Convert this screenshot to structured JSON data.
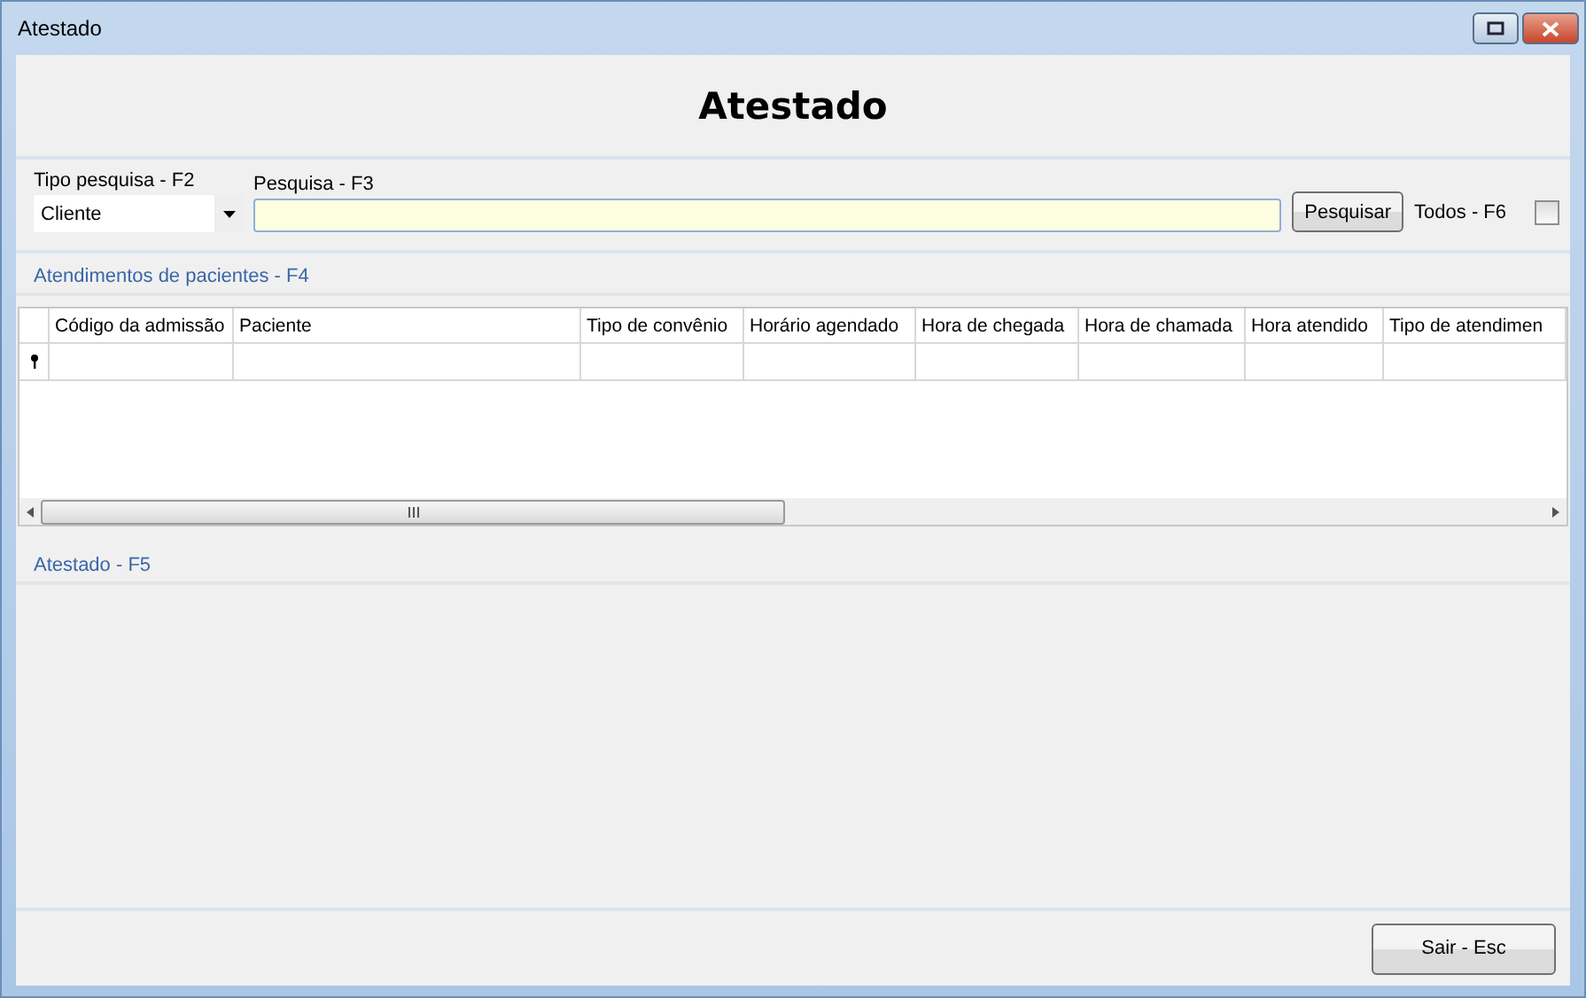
{
  "window": {
    "title": "Atestado"
  },
  "header": {
    "title": "Atestado"
  },
  "search": {
    "type_label": "Tipo pesquisa - F2",
    "type_value": "Cliente",
    "query_label": "Pesquisa - F3",
    "button": "Pesquisar",
    "all_label": "Todos - F6",
    "all_checked": false
  },
  "attendances": {
    "title": "Atendimentos de pacientes - F4",
    "columns": [
      "Código da admissão",
      "Paciente",
      "Tipo de convênio",
      "Horário agendado",
      "Hora de chegada",
      "Hora de chamada",
      "Hora atendido",
      "Tipo de atendimen"
    ]
  },
  "certificate": {
    "title": "Atestado - F5"
  },
  "footer": {
    "button": "Sair - Esc"
  }
}
